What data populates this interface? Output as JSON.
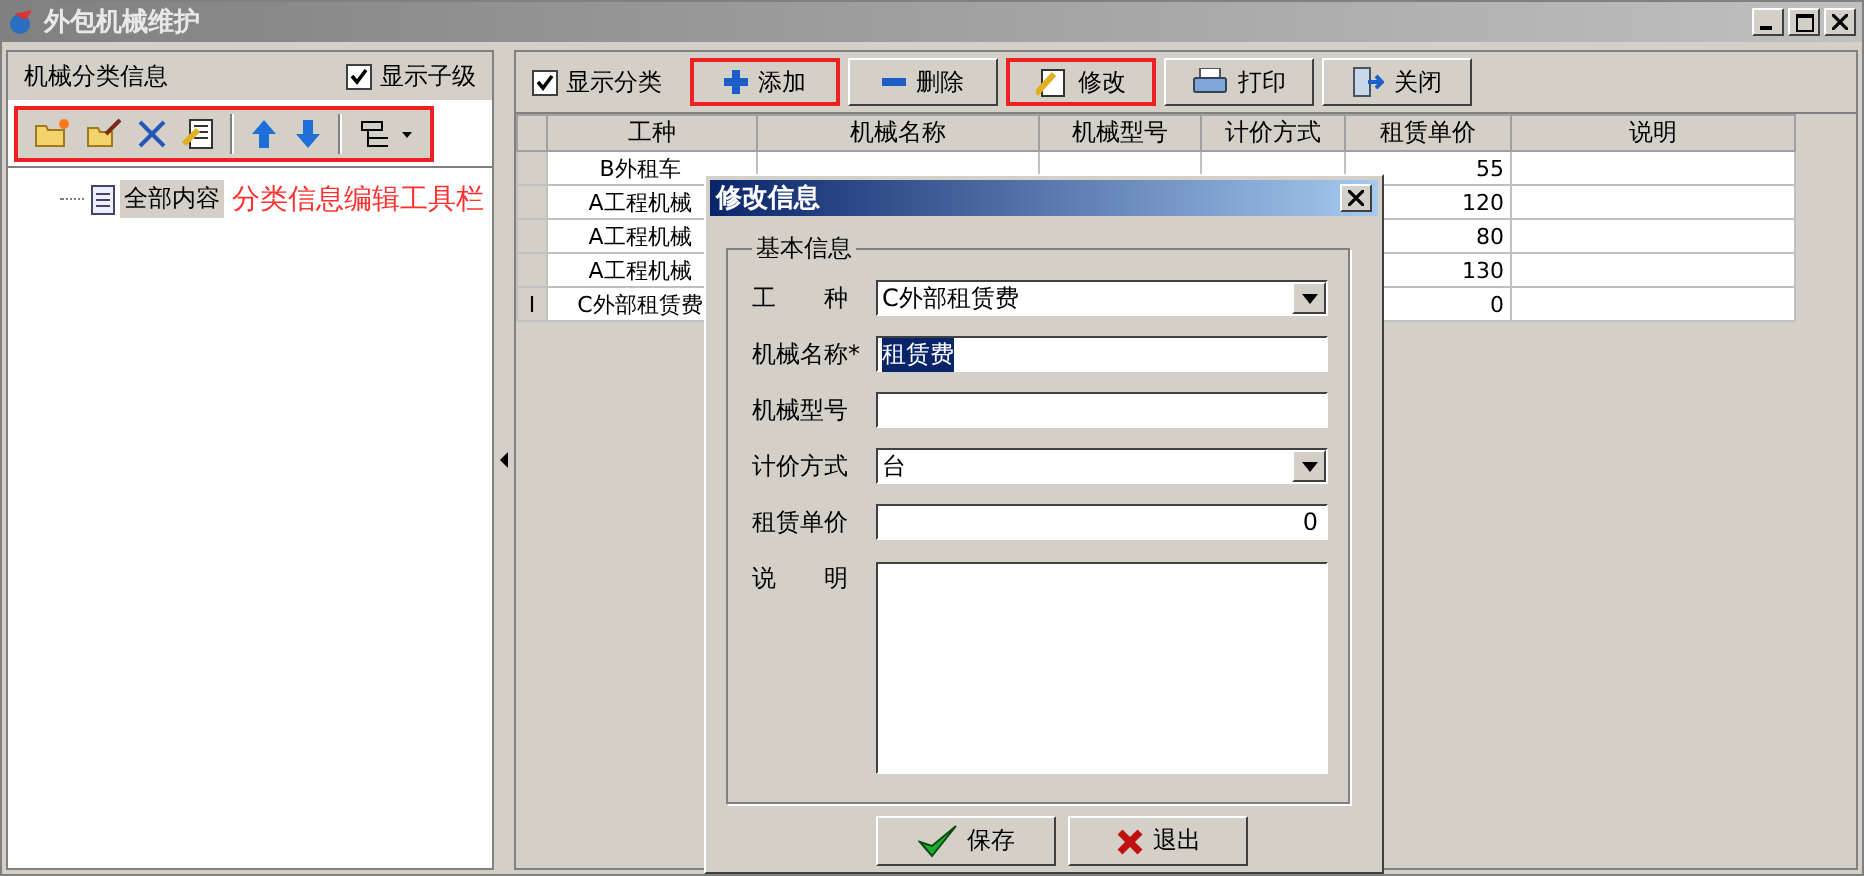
{
  "window": {
    "title": "外包机械维护"
  },
  "left": {
    "title": "机械分类信息",
    "show_children": {
      "label": "显示子级",
      "checked": true
    },
    "toolbar_highlighted": true,
    "toolbar": [
      {
        "kind": "folder-new"
      },
      {
        "kind": "folder-edit"
      },
      {
        "kind": "delete"
      },
      {
        "kind": "doc-edit"
      },
      {
        "kind": "sep"
      },
      {
        "kind": "up"
      },
      {
        "kind": "down"
      },
      {
        "kind": "sep"
      },
      {
        "kind": "tree-menu"
      }
    ],
    "tree": [
      {
        "label": "全部内容",
        "selected": true
      }
    ],
    "annotation": "分类信息编辑工具栏"
  },
  "right": {
    "show_category": {
      "label": "显示分类",
      "checked": true
    },
    "buttons": [
      {
        "label": "添加",
        "kind": "add",
        "highlighted": true
      },
      {
        "label": "删除",
        "kind": "remove",
        "highlighted": false
      },
      {
        "label": "修改",
        "kind": "edit",
        "highlighted": true
      },
      {
        "label": "打印",
        "kind": "print",
        "highlighted": false
      },
      {
        "label": "关闭",
        "kind": "close",
        "highlighted": false
      }
    ],
    "table": {
      "columns": [
        "工种",
        "机械名称",
        "机械型号",
        "计价方式",
        "租赁单价",
        "说明"
      ],
      "rows": [
        {
          "marker": "",
          "cells": [
            "B外租车",
            "",
            "",
            "",
            "55",
            ""
          ]
        },
        {
          "marker": "",
          "cells": [
            "A工程机械",
            "",
            "",
            "",
            "120",
            ""
          ]
        },
        {
          "marker": "",
          "cells": [
            "A工程机械",
            "",
            "",
            "",
            "80",
            ""
          ]
        },
        {
          "marker": "",
          "cells": [
            "A工程机械",
            "",
            "",
            "",
            "130",
            ""
          ]
        },
        {
          "marker": "I",
          "cells": [
            "C外部租赁费",
            "",
            "",
            "",
            "0",
            ""
          ]
        }
      ]
    }
  },
  "dialog": {
    "title": "修改信息",
    "group": "基本信息",
    "fields": [
      {
        "label": "工　　种",
        "kind": "select",
        "value": "C外部租赁费"
      },
      {
        "label": "机械名称*",
        "kind": "text",
        "value": "租赁费",
        "text_selected": true
      },
      {
        "label": "机械型号",
        "kind": "text"
      },
      {
        "label": "计价方式",
        "kind": "select",
        "value": "台"
      },
      {
        "label": "租赁单价",
        "kind": "number",
        "value": "0"
      },
      {
        "label": "说　　明",
        "kind": "textarea"
      }
    ],
    "buttons": [
      {
        "label": "保存",
        "kind": "save"
      },
      {
        "label": "退出",
        "kind": "exit"
      }
    ]
  }
}
